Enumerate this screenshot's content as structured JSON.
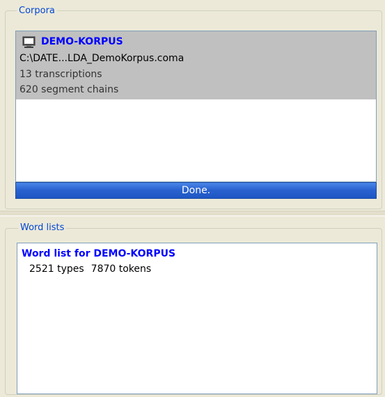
{
  "corpora": {
    "title": "Corpora",
    "items": [
      {
        "name": "DEMO-KORPUS",
        "path": "C:\\DATE...LDA_DemoKorpus.coma",
        "transcriptions": "13 transcriptions",
        "segment_chains": "620 segment chains",
        "icon": "monitor-icon"
      }
    ],
    "progress": {
      "label": "Done.",
      "value": 1.0,
      "color": "#2a63d0"
    }
  },
  "word_lists": {
    "title": "Word lists",
    "items": [
      {
        "title": "Word list for DEMO-KORPUS",
        "types": "2521 types",
        "tokens": "7870 tokens"
      }
    ]
  },
  "colors": {
    "accent_blue": "#0000ff",
    "group_title": "#0046d5",
    "selection": "#c0c0c0",
    "window_bg": "#ece9d8"
  }
}
